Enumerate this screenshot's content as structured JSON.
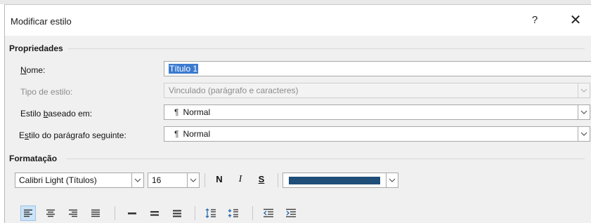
{
  "dialog": {
    "title": "Modificar estilo",
    "help_label": "?",
    "close_label": "✕"
  },
  "properties": {
    "group_label": "Propriedades",
    "name_label_u": "N",
    "name_label_rest": "ome:",
    "name_value": "Título 1",
    "style_type_label": "Tipo de estilo:",
    "style_type_value": "Vinculado (parágrafo e caracteres)",
    "based_on_label_pre": "Estilo ",
    "based_on_label_u": "b",
    "based_on_label_rest": "aseado em:",
    "based_on_value": "Normal",
    "next_style_label_pre": "E",
    "next_style_label_u": "s",
    "next_style_label_rest": "tilo do parágrafo seguinte:",
    "next_style_value": "Normal",
    "pilcrow": "¶"
  },
  "formatting": {
    "group_label": "Formatação",
    "font_name": "Calibri Light (Títulos)",
    "font_size": "16",
    "bold_label": "N",
    "italic_label": "I",
    "underline_label": "S",
    "font_color": "#1f4e79"
  },
  "icons": {
    "close": "close-icon",
    "dropdown": "chevron-down-icon",
    "align_left": "align-left-icon",
    "align_center": "align-center-icon",
    "align_right": "align-right-icon",
    "justify": "justify-icon",
    "line_spacing_single": "line-spacing-single-icon",
    "line_spacing_onehalf": "line-spacing-onehalf-icon",
    "line_spacing_double": "line-spacing-double-icon",
    "space_before": "space-before-icon",
    "space_after": "space-after-icon",
    "decrease_indent": "decrease-indent-icon",
    "increase_indent": "increase-indent-icon"
  },
  "colors": {
    "selection": "#3b7ad0",
    "active_button": "#cce4f7",
    "icon_accent": "#2b6cb0"
  }
}
